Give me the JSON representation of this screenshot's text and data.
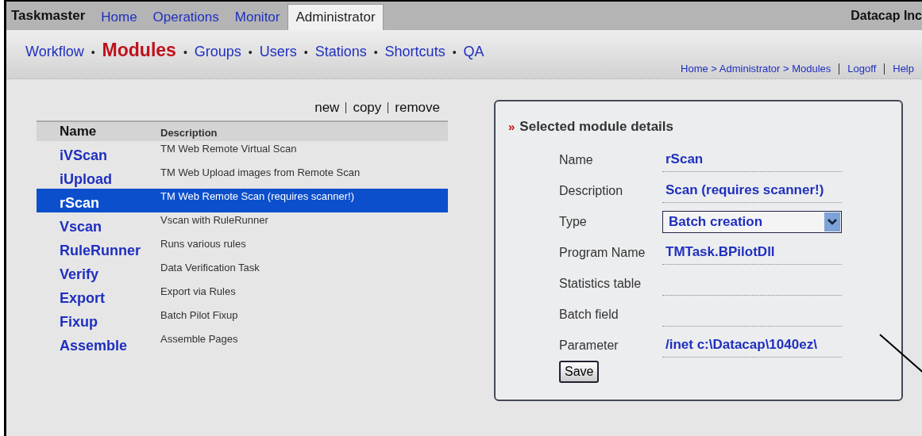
{
  "app_title": "Taskmaster",
  "tabs": [
    {
      "label": "Home",
      "selected": false
    },
    {
      "label": "Operations",
      "selected": false
    },
    {
      "label": "Monitor",
      "selected": false
    },
    {
      "label": "Administrator",
      "selected": true
    }
  ],
  "company": "Datacap Inc",
  "subnav": [
    {
      "label": "Workflow",
      "selected": false
    },
    {
      "label": "Modules",
      "selected": true
    },
    {
      "label": "Groups",
      "selected": false
    },
    {
      "label": "Users",
      "selected": false
    },
    {
      "label": "Stations",
      "selected": false
    },
    {
      "label": "Shortcuts",
      "selected": false
    },
    {
      "label": "QA",
      "selected": false
    }
  ],
  "subnav_separator": "•",
  "breadcrumb": "Home > Administrator > Modules",
  "header_links": [
    "Logoff",
    "Help"
  ],
  "actions": [
    "new",
    "copy",
    "remove"
  ],
  "table": {
    "columns": [
      "Name",
      "Description"
    ],
    "rows": [
      {
        "name": "iVScan",
        "description": "TM Web Remote Virtual Scan",
        "selected": false
      },
      {
        "name": "iUpload",
        "description": "TM Web Upload images from Remote Scan",
        "selected": false
      },
      {
        "name": "rScan",
        "description": "TM Web Remote Scan (requires scanner!)",
        "selected": true
      },
      {
        "name": "Vscan",
        "description": "Vscan with RuleRunner",
        "selected": false
      },
      {
        "name": "RuleRunner",
        "description": "Runs various rules",
        "selected": false
      },
      {
        "name": "Verify",
        "description": "Data Verification Task",
        "selected": false
      },
      {
        "name": "Export",
        "description": "Export via Rules",
        "selected": false
      },
      {
        "name": "Fixup",
        "description": "Batch Pilot Fixup",
        "selected": false
      },
      {
        "name": "Assemble",
        "description": "Assemble Pages",
        "selected": false
      }
    ]
  },
  "details": {
    "marker": "»",
    "title": "Selected module details",
    "fields": [
      {
        "kind": "text",
        "label": "Name",
        "value": "rScan"
      },
      {
        "kind": "text",
        "label": "Description",
        "value": "Scan (requires scanner!)"
      },
      {
        "kind": "select",
        "label": "Type",
        "value": "Batch creation"
      },
      {
        "kind": "text",
        "label": "Program Name",
        "value": "TMTask.BPilotDll"
      },
      {
        "kind": "text",
        "label": "Statistics table"
      },
      {
        "kind": "text",
        "label": "Batch field"
      },
      {
        "kind": "text",
        "label": "Parameter",
        "value": "/inet c:\\Datacap\\1040ez\\"
      }
    ],
    "button": "Save"
  }
}
